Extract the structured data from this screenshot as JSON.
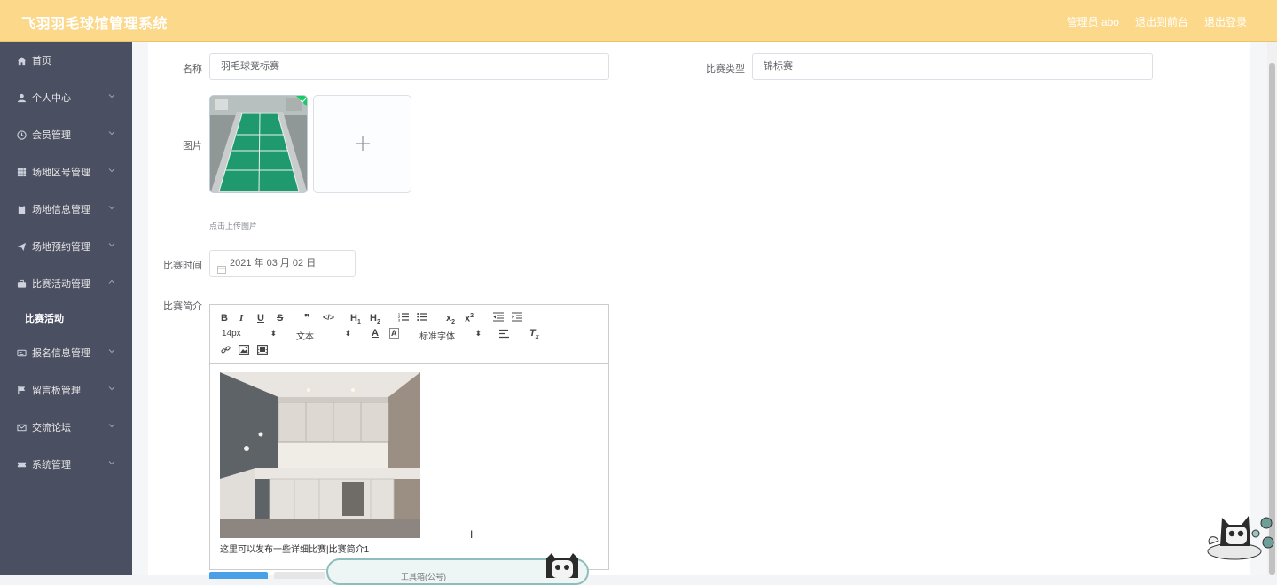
{
  "header": {
    "title": "飞羽羽毛球馆管理系统",
    "user": "管理员 abo",
    "back_front": "退出到前台",
    "logout": "退出登录"
  },
  "sidebar": {
    "items": [
      {
        "label": "首页",
        "icon": "home-icon"
      },
      {
        "label": "个人中心",
        "icon": "user-icon"
      },
      {
        "label": "会员管理",
        "icon": "clock-icon"
      },
      {
        "label": "场地区号管理",
        "icon": "grid-icon"
      },
      {
        "label": "场地信息管理",
        "icon": "clipboard-icon"
      },
      {
        "label": "场地预约管理",
        "icon": "send-icon"
      },
      {
        "label": "比赛活动管理",
        "icon": "briefcase-icon"
      },
      {
        "label": "报名信息管理",
        "icon": "ticket-icon"
      },
      {
        "label": "留言板管理",
        "icon": "flag-icon"
      },
      {
        "label": "交流论坛",
        "icon": "mail-icon"
      },
      {
        "label": "系统管理",
        "icon": "ticket-alt-icon"
      }
    ],
    "sub_item": "比赛活动"
  },
  "form": {
    "name_label": "名称",
    "name_value": "羽毛球竞标赛",
    "type_label": "比赛类型",
    "type_value": "锦标赛",
    "image_label": "图片",
    "upload_hint": "点击上传图片",
    "time_label": "比赛时间",
    "time_value": "2021 年 03 月 02 日",
    "intro_label": "比赛简介"
  },
  "editor": {
    "font_size": "14px",
    "block_type": "文本",
    "font_family": "标准字体",
    "content_text": "这里可以发布一些详细比赛|比赛简介1"
  },
  "popup": {
    "text": "工具箱(公号)"
  },
  "colors": {
    "header_bg": "#fbd88a",
    "sidebar_bg": "#4b4f62",
    "court_green": "#1f9a6e"
  }
}
